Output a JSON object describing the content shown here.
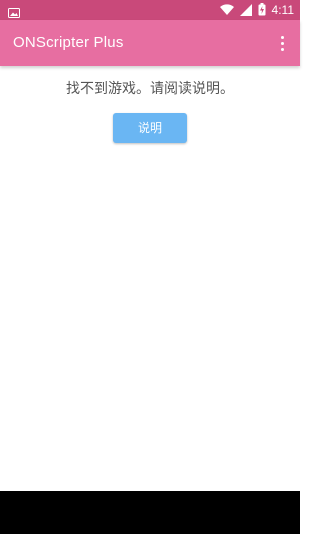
{
  "status_bar": {
    "time": "4:11",
    "icons": [
      "image-notification-icon",
      "wifi-icon",
      "signal-icon",
      "battery-charging-icon"
    ]
  },
  "app_bar": {
    "title": "ONScripter Plus",
    "overflow_icon": "more-vert-icon"
  },
  "main": {
    "message": "找不到游戏。请阅读说明。",
    "help_button_label": "说明"
  },
  "colors": {
    "status_bar": "#c9497a",
    "app_bar": "#e76ea1",
    "button": "#6ab6f3",
    "message_text": "#555555"
  }
}
